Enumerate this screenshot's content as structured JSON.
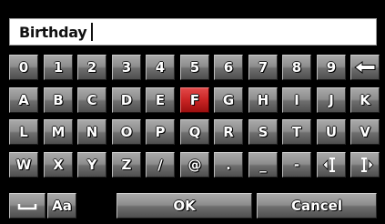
{
  "input": {
    "value": "Birthday"
  },
  "rows": [
    [
      "0",
      "1",
      "2",
      "3",
      "4",
      "5",
      "6",
      "7",
      "8",
      "9"
    ],
    [
      "A",
      "B",
      "C",
      "D",
      "E",
      "F",
      "G",
      "H",
      "I",
      "J",
      "K"
    ],
    [
      "L",
      "M",
      "N",
      "O",
      "P",
      "Q",
      "R",
      "S",
      "T",
      "U",
      "V"
    ],
    [
      "W",
      "X",
      "Y",
      "Z",
      "/",
      "@",
      ".",
      "_",
      "-"
    ]
  ],
  "selected_key": "F",
  "bottom": {
    "case_label": "Aa",
    "ok_label": "OK",
    "cancel_label": "Cancel"
  },
  "icons": {
    "backspace": "backspace-arrow-icon",
    "cursor_left": "cursor-left-icon",
    "cursor_right": "cursor-right-icon",
    "space": "space-icon"
  },
  "colors": {
    "key": "#8d8d8d",
    "selected_key": "#c92424",
    "background": "#000000"
  }
}
